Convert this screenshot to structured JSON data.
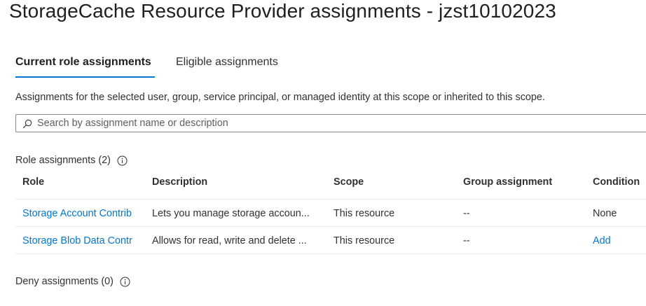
{
  "page": {
    "title": "StorageCache Resource Provider assignments - jzst10102023"
  },
  "tabs": [
    {
      "label": "Current role assignments",
      "selected": true
    },
    {
      "label": "Eligible assignments",
      "selected": false
    }
  ],
  "description": "Assignments for the selected user, group, service principal, or managed identity at this scope or inherited to this scope.",
  "search": {
    "placeholder": "Search by assignment name or description",
    "value": ""
  },
  "role_assignments": {
    "label": "Role assignments (2)",
    "columns": [
      "Role",
      "Description",
      "Scope",
      "Group assignment",
      "Condition"
    ],
    "rows": [
      {
        "role": "Storage Account Contrib",
        "description": "Lets you manage storage accoun...",
        "scope": "This resource",
        "group": "--",
        "condition": "None"
      },
      {
        "role": "Storage Blob Data Contr",
        "description": "Allows for read, write and delete ...",
        "scope": "This resource",
        "group": "--",
        "condition": "Add"
      }
    ]
  },
  "deny_assignments": {
    "label": "Deny assignments (0)"
  },
  "colors": {
    "accent": "#0078d4",
    "text": "#323130",
    "border": "#edebe9"
  },
  "icons": {
    "search": "search-icon",
    "info": "info-icon"
  }
}
